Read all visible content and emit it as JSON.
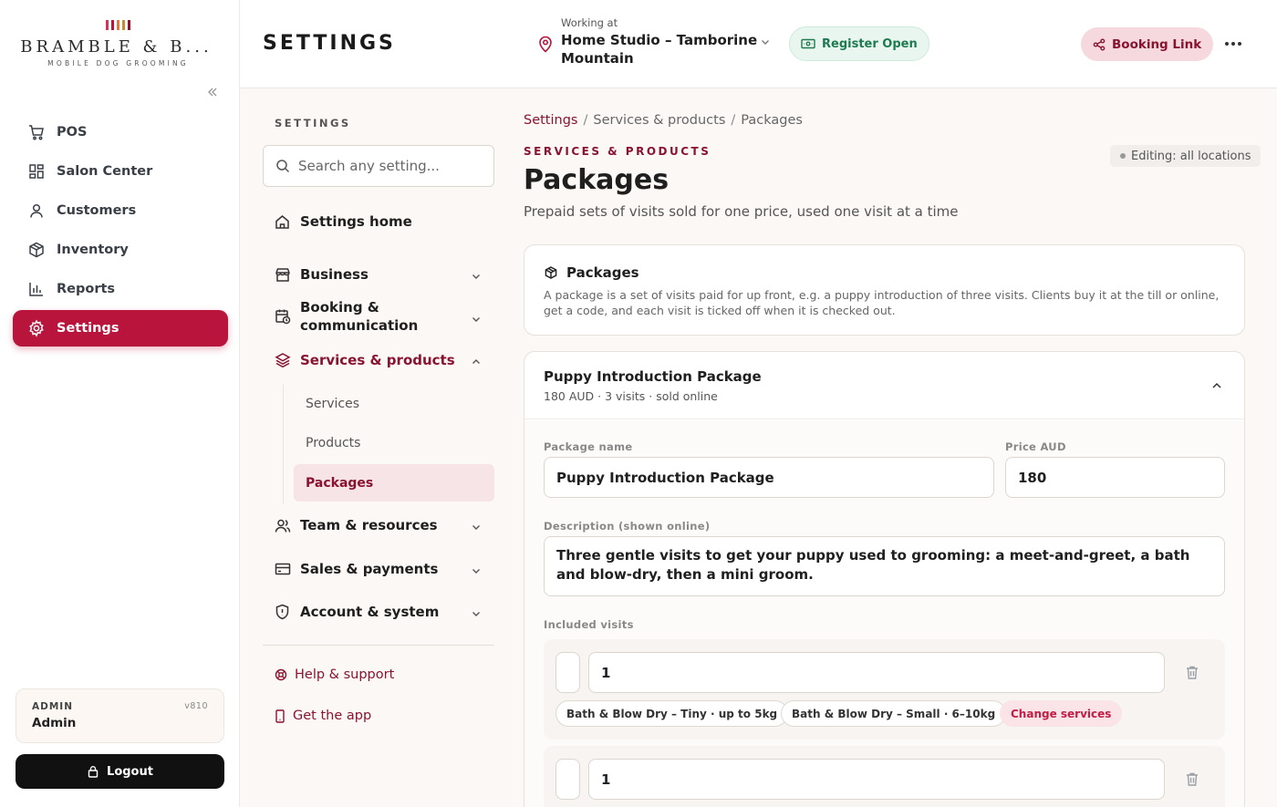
{
  "brand": {
    "name": "BRAMBLE & B...",
    "tagline": "MOBILE DOG GROOMING",
    "bar_colors": [
      "#d6325a",
      "#b8143c",
      "#e07a3a",
      "#c78a2c",
      "#8a1330"
    ]
  },
  "sidebar": {
    "items": [
      {
        "label": "POS",
        "icon": "cart-icon"
      },
      {
        "label": "Salon Center",
        "icon": "grid-icon"
      },
      {
        "label": "Customers",
        "icon": "user-icon"
      },
      {
        "label": "Inventory",
        "icon": "box-icon"
      },
      {
        "label": "Reports",
        "icon": "bar-chart-icon"
      },
      {
        "label": "Settings",
        "icon": "gear-icon",
        "active": true
      }
    ],
    "admin": {
      "role": "ADMIN",
      "version": "v810",
      "name": "Admin"
    },
    "logout_label": "Logout"
  },
  "header": {
    "title": "SETTINGS",
    "working_at_label": "Working at",
    "location_line1": "Home Studio – Tamborine",
    "location_line2": "Mountain",
    "register_label": "Register Open",
    "booking_link_label": "Booking Link"
  },
  "settings_nav": {
    "heading": "SETTINGS",
    "search_placeholder": "Search any setting...",
    "home": "Settings home",
    "business": "Business",
    "booking_1": "Booking &",
    "booking_2": "communication",
    "services_products": "Services & products",
    "sub": [
      "Services",
      "Products",
      "Packages"
    ],
    "team": "Team & resources",
    "sales": "Sales & payments",
    "account": "Account & system",
    "help": "Help & support",
    "get_app": "Get the app"
  },
  "main": {
    "breadcrumb": [
      "Settings",
      "Services & products",
      "Packages"
    ],
    "eyebrow": "SERVICES & PRODUCTS",
    "editing_badge": "Editing: all locations",
    "title": "Packages",
    "lede": "Prepaid sets of visits sold for one price, used one visit at a time",
    "info": {
      "title": "Packages",
      "text": "A package is a set of visits paid for up front, e.g. a puppy introduction of three visits. Clients buy it at the till or online, get a code, and each visit is ticked off when it is checked out."
    },
    "package": {
      "title": "Puppy Introduction Package",
      "summary": "180 AUD · 3 visits · sold online",
      "name_label": "Package name",
      "name_value": "Puppy Introduction Package",
      "price_label": "Price AUD",
      "price_value": "180",
      "desc_label": "Description (shown online)",
      "desc_value": "Three gentle visits to get your puppy used to grooming: a meet-and-greet, a bath and blow-dry, then a mini groom.",
      "visits_label": "Included visits",
      "visits": [
        {
          "count": "1",
          "services": [
            "Bath & Blow Dry – Tiny · up to 5kg",
            "Bath & Blow Dry – Small · 6–10kg"
          ],
          "change_label": "Change services"
        },
        {
          "count": "1"
        }
      ]
    }
  },
  "colors": {
    "accent": "#b8143c",
    "accent_dark": "#8a1330",
    "register_green": "#1f7a4f"
  }
}
